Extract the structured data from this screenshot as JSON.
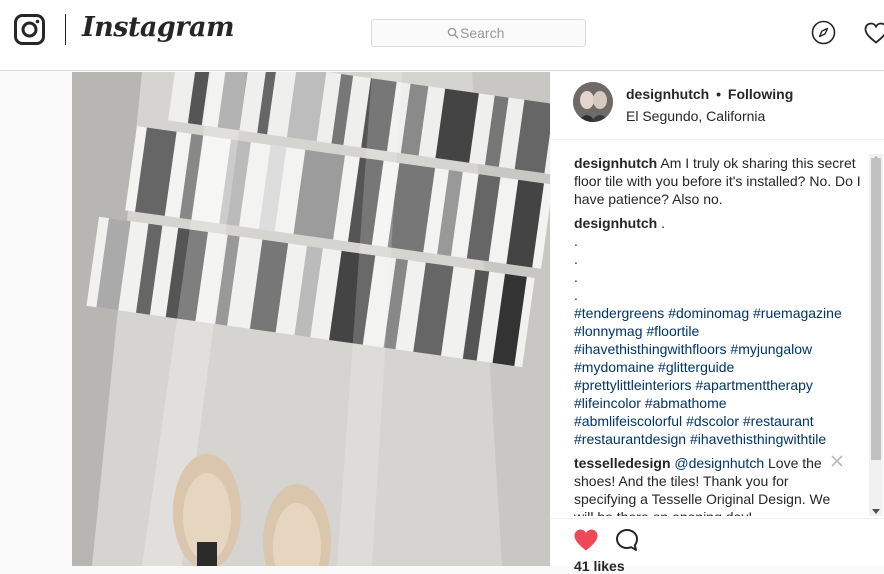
{
  "topbar": {
    "brand": "Instagram",
    "search_placeholder": "Search"
  },
  "post": {
    "author": "designhutch",
    "separator": "•",
    "follow_status": "Following",
    "location": "El Segundo, California",
    "caption": {
      "username": "designhutch",
      "text": "Am I truly ok sharing this secret floor tile with you before it's installed? No. Do I have patience? Also no."
    },
    "hashtag_comment": {
      "username": "designhutch",
      "text": ".",
      "dots": [
        ".",
        ".",
        ".",
        "."
      ],
      "lines": [
        [
          "#tendergreens",
          "#dominomag",
          "#ruemagazine"
        ],
        [
          "#lonnymag",
          "#floortile"
        ],
        [
          "#ihavethisthingwithfloors",
          "#myjungalow"
        ],
        [
          "#mydomaine",
          "#glitterguide"
        ],
        [
          "#prettylittleinteriors",
          "#apartmenttherapy"
        ],
        [
          "#lifeincolor",
          "#abmathome"
        ],
        [
          "#abmlifeiscolorful",
          "#dscolor",
          "#restaurant"
        ],
        [
          "#restaurantdesign",
          "#ihavethisthingwithtile"
        ]
      ]
    },
    "reply": {
      "username": "tesselledesign",
      "mention": "@designhutch",
      "text": "Love the shoes! And the tiles! Thank you for specifying a Tesselle Original Design. We will be there on opening day!"
    },
    "likes_text": "41 likes",
    "like_color": "#ed4956"
  },
  "icons": {
    "logo": "instagram-camera-icon",
    "search": "search-icon",
    "explore": "compass-icon",
    "activity": "heart-outline-icon",
    "like": "heart-filled-icon",
    "comment": "speech-bubble-icon",
    "close": "close-icon"
  }
}
